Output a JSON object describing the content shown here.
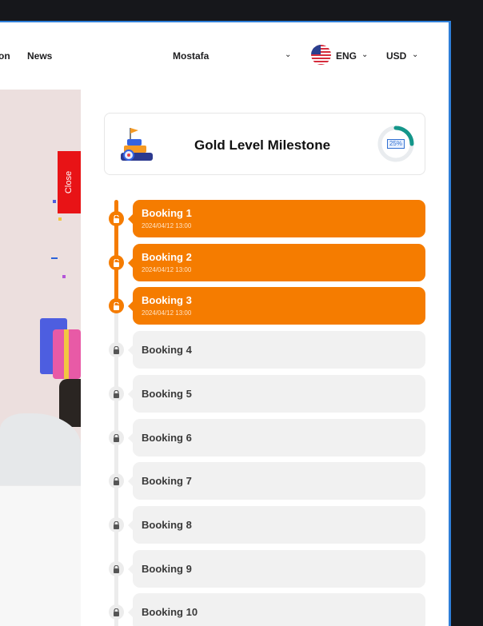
{
  "nav": {
    "link_partial": "on",
    "link_news": "News",
    "user_name": "Mostafa",
    "language": "ENG",
    "currency": "USD"
  },
  "sidebar_tab": {
    "close_label": "Close"
  },
  "milestone": {
    "title": "Gold Level Milestone",
    "progress_label": "25%",
    "progress_fraction": 0.25,
    "ring_color": "#14968a"
  },
  "colors": {
    "accent": "#f57c00",
    "locked": "#f1f1f1"
  },
  "bookings": [
    {
      "label": "Booking 1",
      "date": "2024/04/12 13:00",
      "status": "done"
    },
    {
      "label": "Booking 2",
      "date": "2024/04/12 13:00",
      "status": "done"
    },
    {
      "label": "Booking 3",
      "date": "2024/04/12 13:00",
      "status": "done"
    },
    {
      "label": "Booking 4",
      "status": "locked"
    },
    {
      "label": "Booking 5",
      "status": "locked"
    },
    {
      "label": "Booking 6",
      "status": "locked"
    },
    {
      "label": "Booking 7",
      "status": "locked"
    },
    {
      "label": "Booking 8",
      "status": "locked"
    },
    {
      "label": "Booking 9",
      "status": "locked"
    },
    {
      "label": "Booking 10",
      "status": "locked"
    }
  ]
}
